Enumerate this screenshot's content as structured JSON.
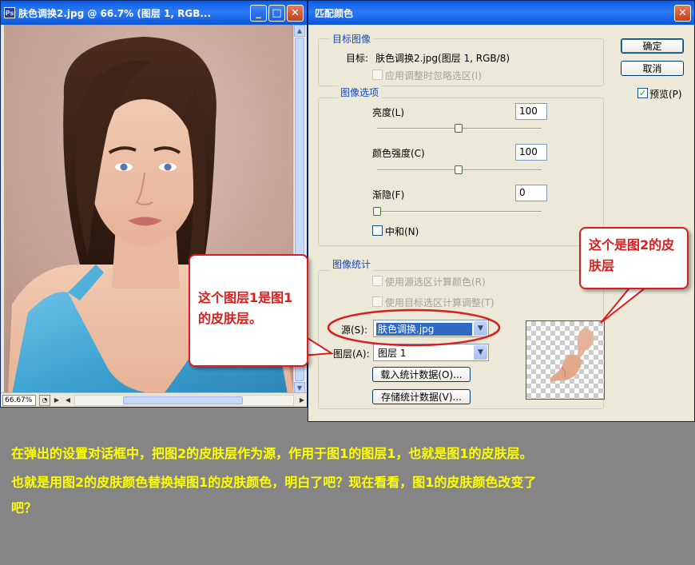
{
  "document_window": {
    "title": "肤色调换2.jpg @ 66.7% (图层 1, RGB...",
    "zoom": "66.67%",
    "min_btn": "_",
    "max_btn": "□",
    "close_btn": "✕"
  },
  "dialog": {
    "title": "匹配颜色",
    "close_btn": "✕",
    "target_group": {
      "title": "目标图像",
      "target_label": "目标:",
      "target_value": "肤色调换2.jpg(图层 1, RGB/8)",
      "ignore_selection": "应用调整时忽略选区(I)"
    },
    "image_options": {
      "title": "图像选项",
      "luminance_label": "亮度(L)",
      "luminance_value": "100",
      "luminance_level": 100,
      "color_intensity_label": "颜色强度(C)",
      "color_intensity_value": "100",
      "color_intensity_level": 100,
      "fade_label": "渐隐(F)",
      "fade_value": "0",
      "fade_level": 0,
      "neutralize_label": "中和(N)"
    },
    "image_stats": {
      "title": "图像统计",
      "use_source_selection": "使用源选区计算颜色(R)",
      "use_target_selection": "使用目标选区计算调整(T)",
      "source_label": "源(S):",
      "source_value": "肤色调换.jpg",
      "layer_label": "图层(A):",
      "layer_value": "图层 1",
      "load_stats": "载入统计数据(O)...",
      "save_stats": "存储统计数据(V)..."
    },
    "ok_button": "确定",
    "cancel_button": "取消",
    "preview_label": "预览(P)",
    "preview_checked": true
  },
  "annotations": {
    "callout_left": "这个图层1是图1的皮肤层。",
    "callout_right": "这个是图2的皮肤层",
    "color": "#d91e1e"
  },
  "caption": {
    "line1": "在弹出的设置对话框中，把图2的皮肤层作为源，作用于图1的图层1，也就是图1的皮肤层。",
    "line2": "也就是用图2的皮肤颜色替换掉图1的皮肤颜色，明白了吧？现在看看，图1的皮肤颜色改变了",
    "line3": "吧？",
    "color": "#ffff00"
  },
  "colors": {
    "titlebar": "#0c56d6",
    "window_bg": "#ece9d8",
    "desktop": "#858585"
  }
}
